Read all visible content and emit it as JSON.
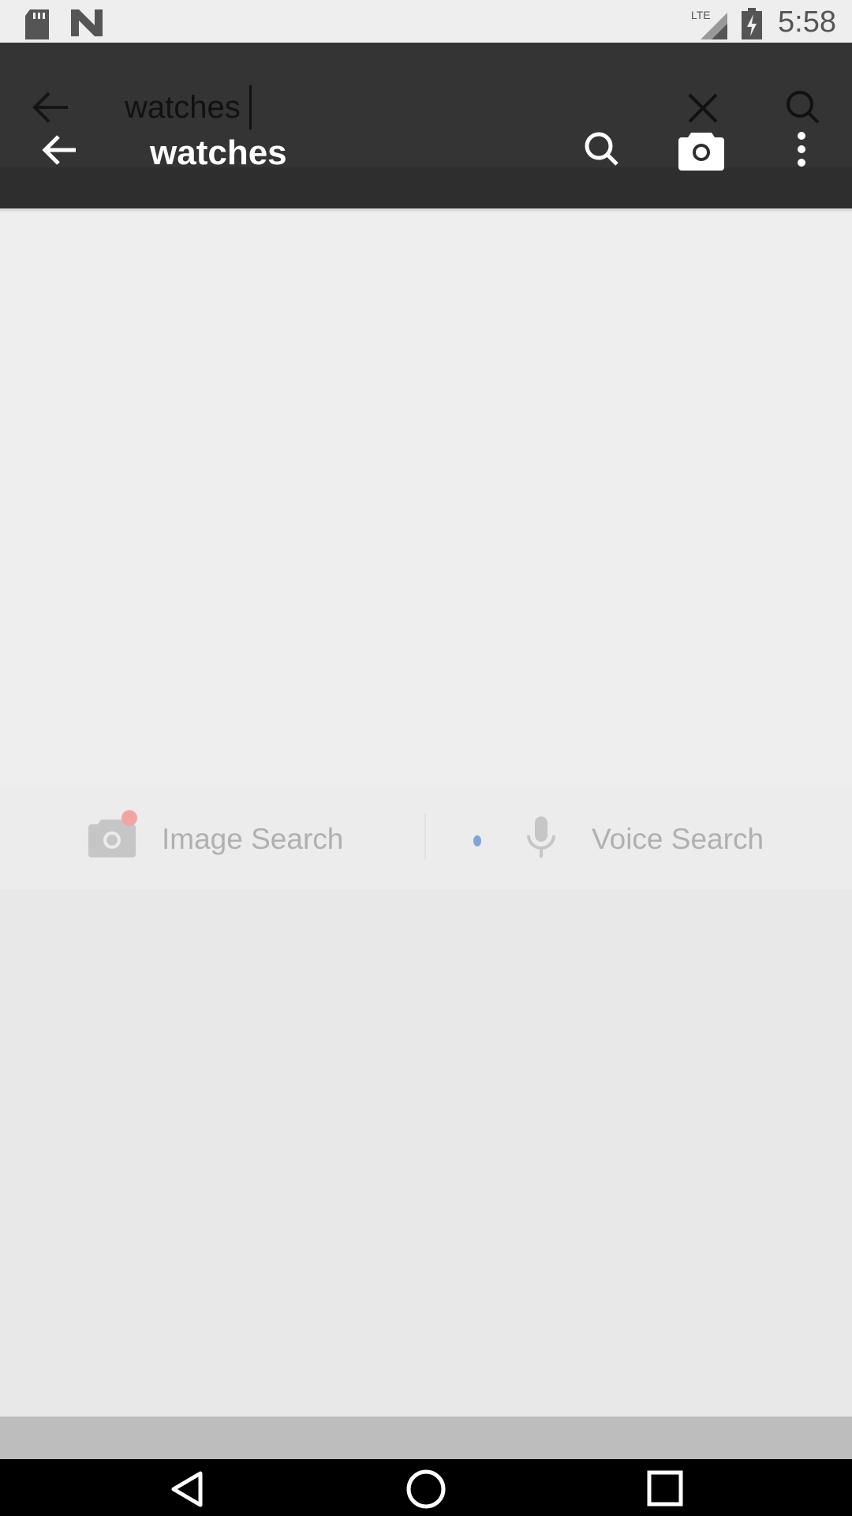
{
  "status_bar": {
    "time": "5:58",
    "network": "LTE",
    "icons": [
      "sd-card-icon",
      "n-logo-icon",
      "lte-signal-icon",
      "battery-charging-icon"
    ]
  },
  "search_bar": {
    "query_value": "watches"
  },
  "toolbar": {
    "title": "watches",
    "icons": [
      "back-arrow-icon",
      "search-icon",
      "camera-icon",
      "more-vert-icon"
    ]
  },
  "search_options": {
    "image_search_label": "Image Search",
    "voice_search_label": "Voice Search"
  },
  "colors": {
    "toolbar_bg": "#2e2e2e",
    "content_bg": "#eeeeee",
    "badge_red": "#f2a3a3",
    "dot_blue": "#7fa7d8"
  }
}
